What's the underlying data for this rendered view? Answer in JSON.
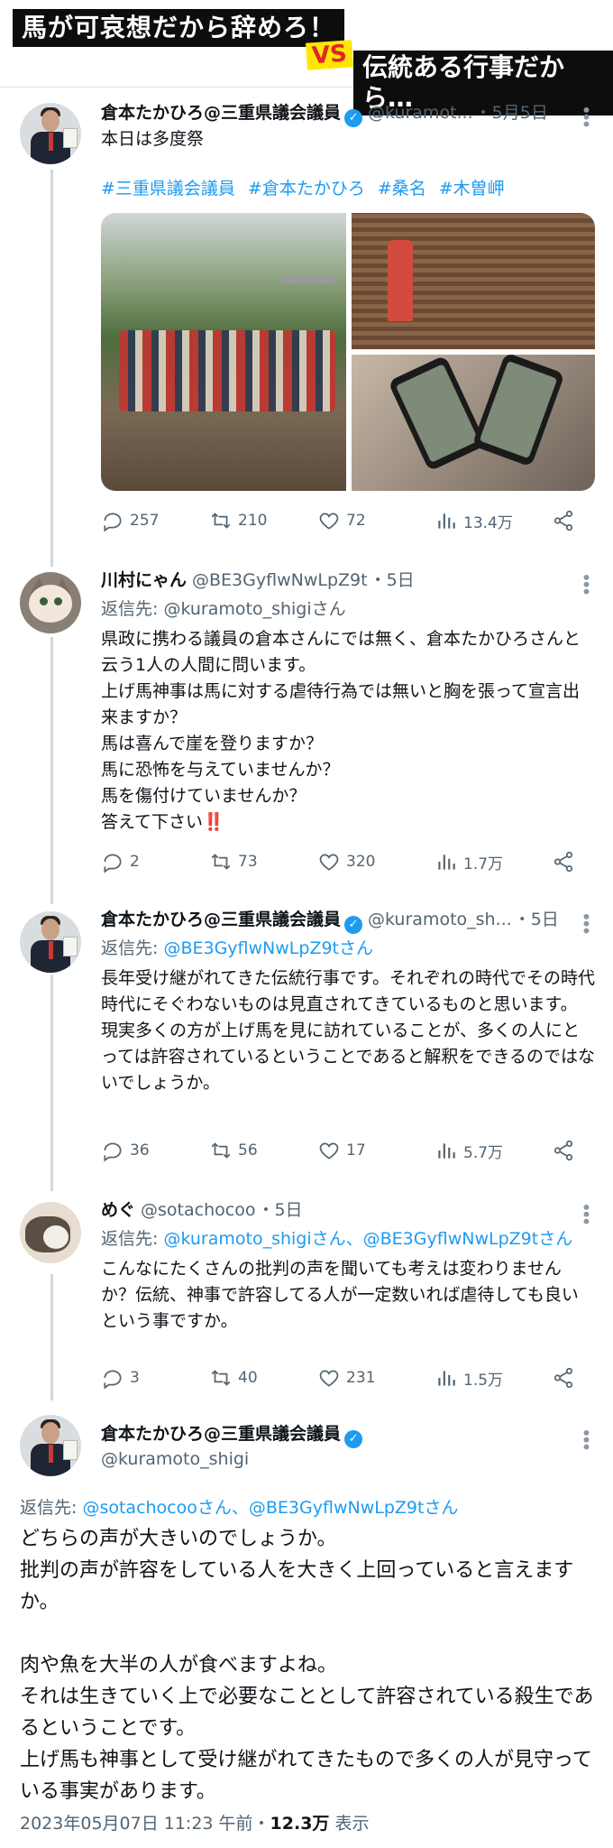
{
  "banner": {
    "left": "馬が可哀想だから辞めろ！",
    "vs": "VS",
    "right": "伝統ある行事だから…"
  },
  "tweets": [
    {
      "name": "倉本たかひろ@三重県議会議員",
      "handle": "@kuramot...",
      "time": "・5月5日",
      "body": "本日は多度祭",
      "hashtags": [
        "#三重県議会議員",
        "#倉本たかひろ",
        "#桑名",
        "#木曽岬"
      ],
      "stats": {
        "replies": "257",
        "retweets": "210",
        "likes": "72",
        "views": "13.4万"
      }
    },
    {
      "name": "川村にゃん",
      "handle": "@BE3GyflwNwLpZ9t",
      "time": "・5日",
      "reply_prefix": "返信先: ",
      "reply_to": "@kuramoto_shigiさん",
      "body": "県政に携わる議員の倉本さんにでは無く、倉本たかひろさんと云う1人の人間に問います。\n上げ馬神事は馬に対する虐待行為では無いと胸を張って宣言出来ますか？\n馬は喜んで崖を登りますか？\n馬に恐怖を与えていませんか？\n馬を傷付けていませんか？\n答えて下さい‼️",
      "stats": {
        "replies": "2",
        "retweets": "73",
        "likes": "320",
        "views": "1.7万"
      }
    },
    {
      "name": "倉本たかひろ@三重県議会議員",
      "handle": "@kuramoto_sh...",
      "time": "・5日",
      "reply_prefix": "返信先: ",
      "reply_to": "@BE3GyflwNwLpZ9tさん",
      "body": "長年受け継がれてきた伝統行事です。それぞれの時代でその時代時代にそぐわないものは見直されてきているものと思います。\n現実多くの方が上げ馬を見に訪れていることが、多くの人にとっては許容されているということであると解釈をできるのではないでしょうか。",
      "stats": {
        "replies": "36",
        "retweets": "56",
        "likes": "17",
        "views": "5.7万"
      }
    },
    {
      "name": "めぐ",
      "handle": "@sotachocoo",
      "time": "・5日",
      "reply_prefix": "返信先: ",
      "reply_to": "@kuramoto_shigiさん、@BE3GyflwNwLpZ9tさん",
      "body": "こんなにたくさんの批判の声を聞いても考えは変わりませんか？伝統、神事で許容してる人が一定数いれば虐待しても良いという事ですか。",
      "stats": {
        "replies": "3",
        "retweets": "40",
        "likes": "231",
        "views": "1.5万"
      }
    },
    {
      "name": "倉本たかひろ@三重県議会議員",
      "handle": "@kuramoto_shigi",
      "reply_prefix": "返信先: ",
      "reply_to": "@sotachocooさん、@BE3GyflwNwLpZ9tさん",
      "body": "どちらの声が大きいのでしょうか。\n批判の声が許容をしている人を大きく上回っていると言えますか。\n\n肉や魚を大半の人が食べますよね。\nそれは生きていく上で必要なこととして許容されている殺生であるということです。\n上げ馬も神事として受け継がれてきたもので多くの人が見守っている事実があります。",
      "date": "2023年05月07日 11:23 午前・",
      "views_count": "12.3万",
      "views_label": " 表示"
    }
  ],
  "colors": {
    "link": "#1d9bf0",
    "muted": "#536471",
    "text": "#0f1419",
    "verified": "#1d9bf0"
  },
  "icons": [
    "reply-icon",
    "retweet-icon",
    "like-icon",
    "views-icon",
    "share-icon",
    "more-icon",
    "verified-icon"
  ]
}
